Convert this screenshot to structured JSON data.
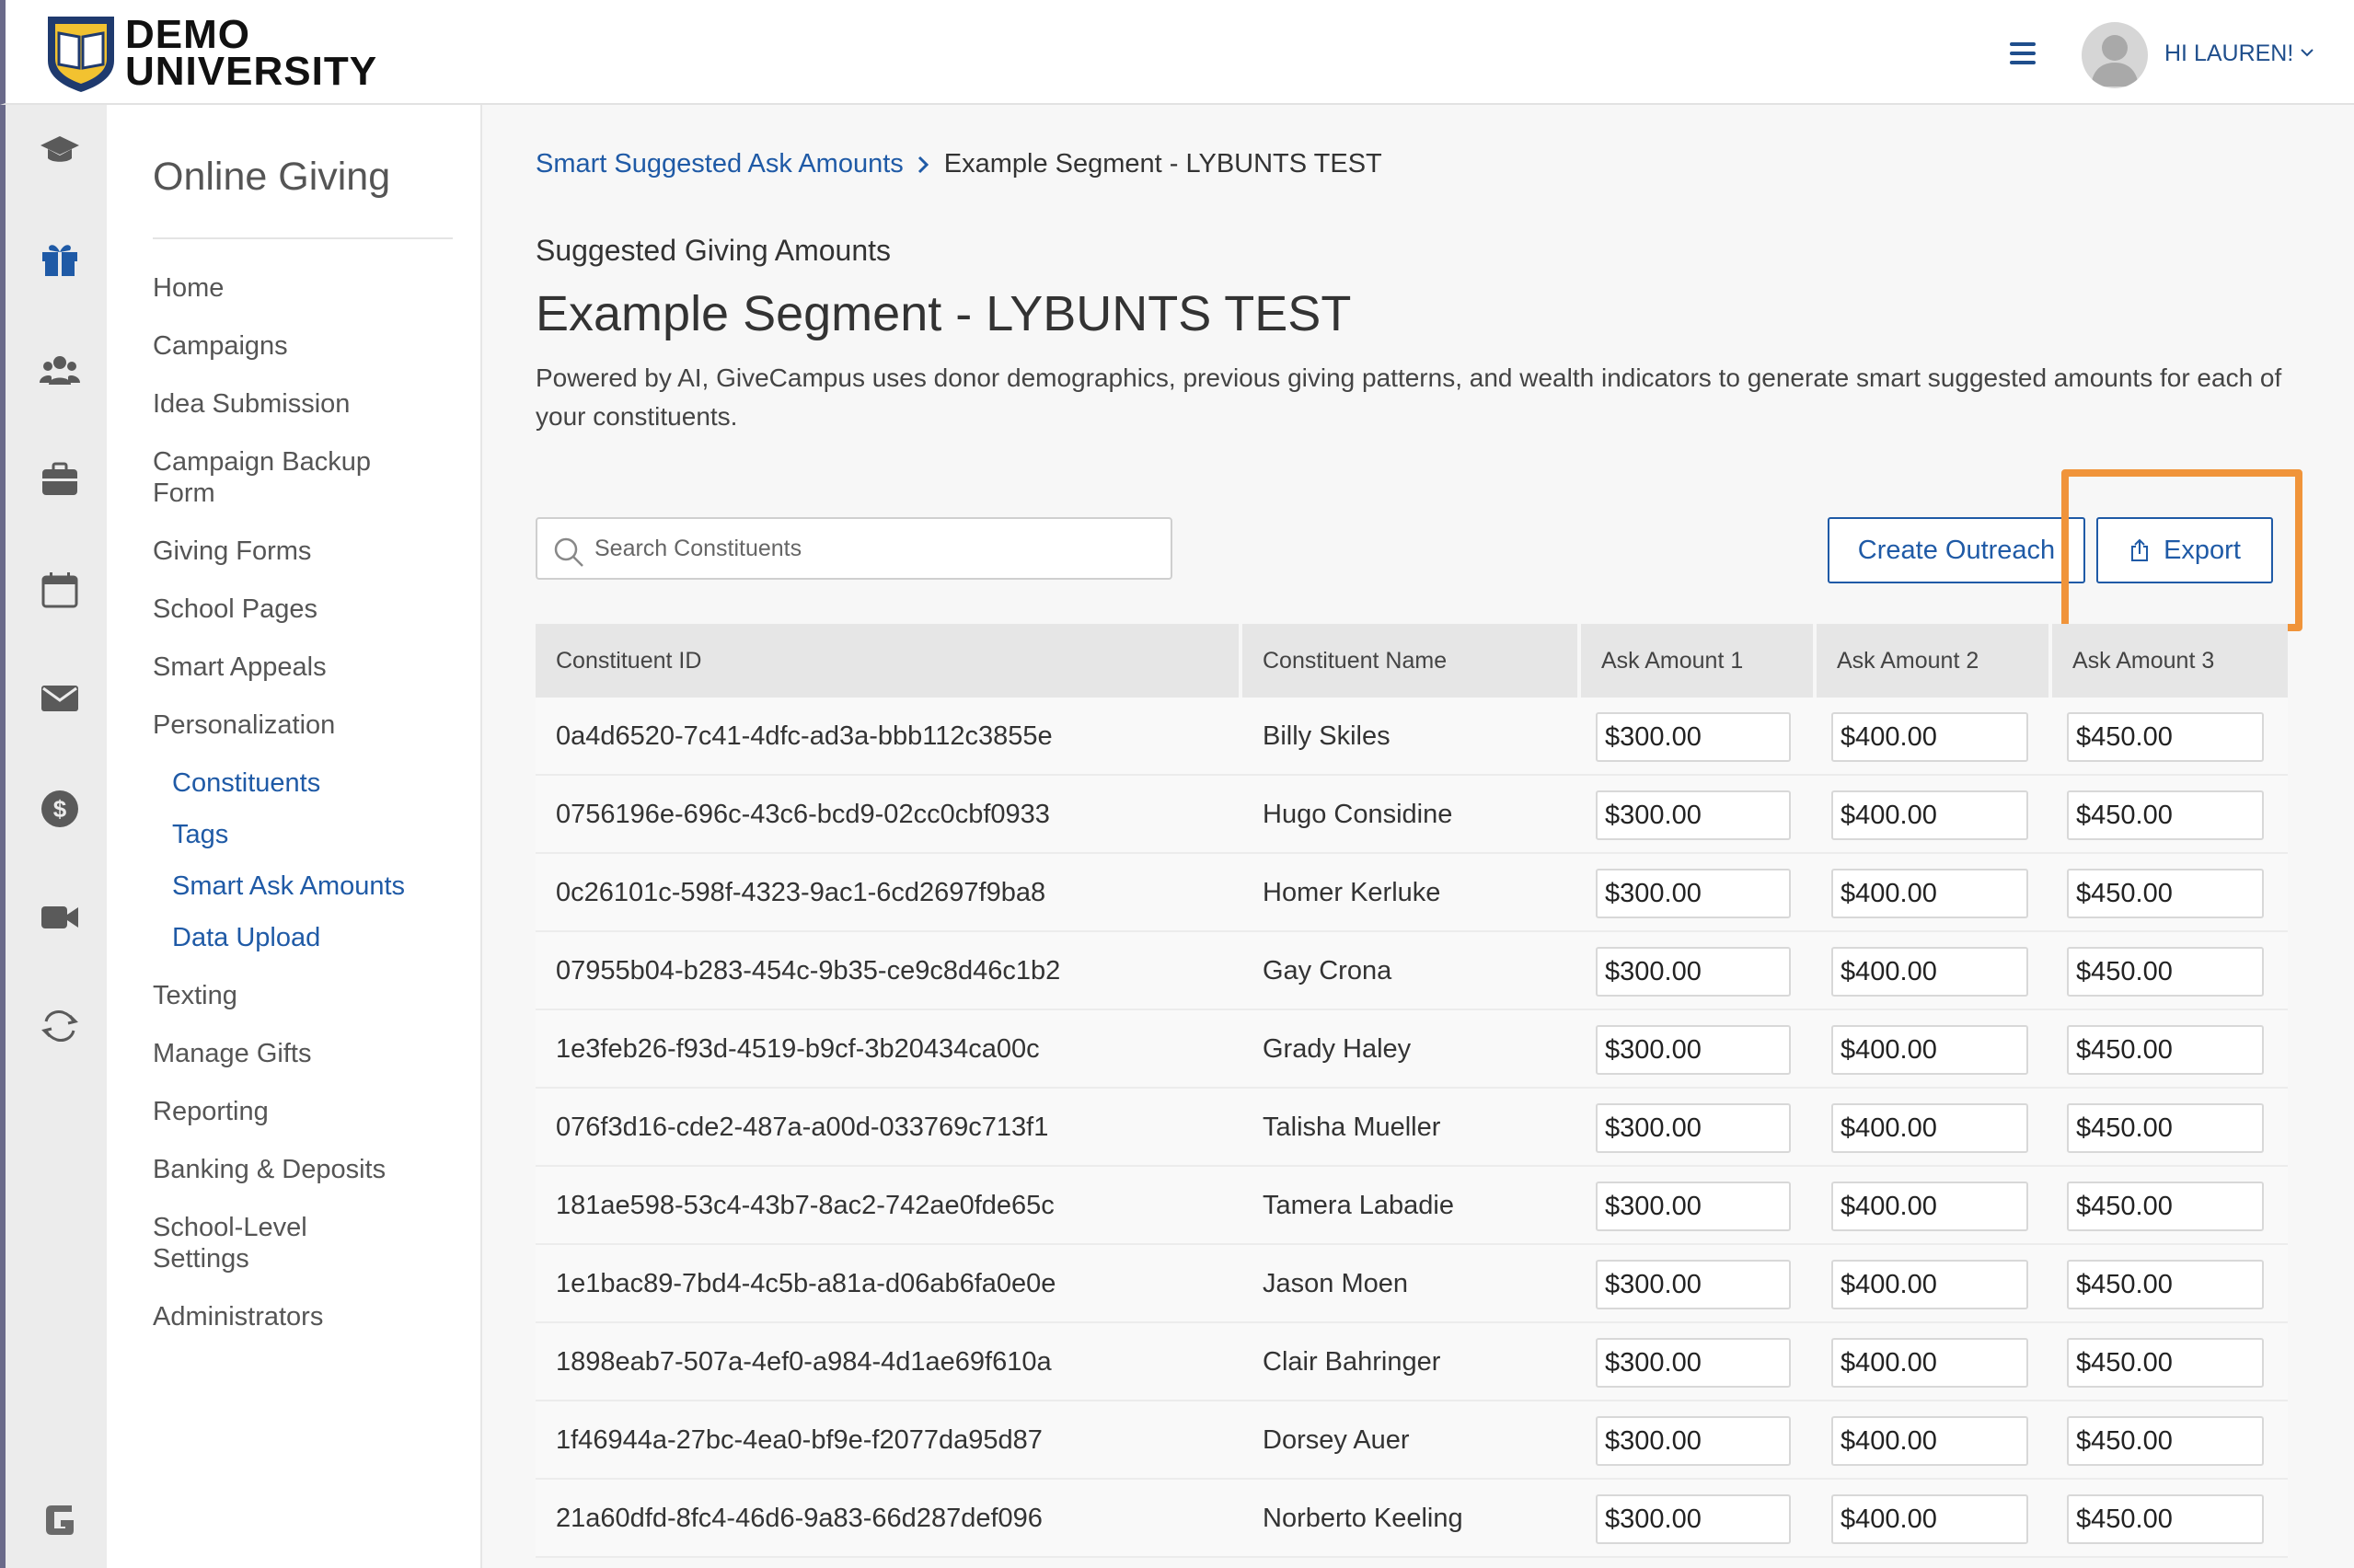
{
  "header": {
    "logo_line1": "DEMO",
    "logo_line2": "UNIVERSITY",
    "greeting": "HI LAUREN!",
    "menu_icon": "hamburger-icon",
    "user_menu_icon": "chevron-down-icon"
  },
  "rail": {
    "icons": [
      "graduation-cap-icon",
      "gift-icon",
      "people-icon",
      "briefcase-icon",
      "calendar-icon",
      "envelope-icon",
      "dollar-icon",
      "video-camera-icon",
      "sync-icon",
      "brand-g-icon"
    ]
  },
  "subnav": {
    "title": "Online Giving",
    "items": {
      "home": "Home",
      "campaigns": "Campaigns",
      "idea_submission": "Idea Submission",
      "campaign_backup_form": "Campaign Backup Form",
      "giving_forms": "Giving Forms",
      "school_pages": "School Pages",
      "smart_appeals": "Smart Appeals",
      "personalization": "Personalization",
      "constituents": "Constituents",
      "tags": "Tags",
      "smart_ask_amounts": "Smart Ask Amounts",
      "data_upload": "Data Upload",
      "texting": "Texting",
      "manage_gifts": "Manage Gifts",
      "reporting": "Reporting",
      "banking_deposits": "Banking & Deposits",
      "school_level_settings": "School-Level Settings",
      "administrators": "Administrators"
    }
  },
  "main": {
    "breadcrumb_parent": "Smart Suggested Ask Amounts",
    "breadcrumb_current": "Example Segment - LYBUNTS TEST",
    "subheading": "Suggested Giving Amounts",
    "heading": "Example Segment - LYBUNTS TEST",
    "description": "Powered by AI, GiveCampus uses donor demographics, previous giving patterns, and wealth indicators to generate smart suggested amounts for each of your constituents.",
    "search_placeholder": "Search Constituents",
    "create_outreach_label": "Create Outreach",
    "export_label": "Export",
    "highlight_color": "#f0943a",
    "accent_color": "#1f5aa6"
  },
  "table": {
    "headers": {
      "id": "Constituent ID",
      "name": "Constituent Name",
      "ask1": "Ask Amount 1",
      "ask2": "Ask Amount 2",
      "ask3": "Ask Amount 3"
    },
    "rows": [
      {
        "id": "0a4d6520-7c41-4dfc-ad3a-bbb112c3855e",
        "name": "Billy Skiles",
        "ask1": "$300.00",
        "ask2": "$400.00",
        "ask3": "$450.00"
      },
      {
        "id": "0756196e-696c-43c6-bcd9-02cc0cbf0933",
        "name": "Hugo Considine",
        "ask1": "$300.00",
        "ask2": "$400.00",
        "ask3": "$450.00"
      },
      {
        "id": "0c26101c-598f-4323-9ac1-6cd2697f9ba8",
        "name": "Homer Kerluke",
        "ask1": "$300.00",
        "ask2": "$400.00",
        "ask3": "$450.00"
      },
      {
        "id": "07955b04-b283-454c-9b35-ce9c8d46c1b2",
        "name": "Gay Crona",
        "ask1": "$300.00",
        "ask2": "$400.00",
        "ask3": "$450.00"
      },
      {
        "id": "1e3feb26-f93d-4519-b9cf-3b20434ca00c",
        "name": "Grady Haley",
        "ask1": "$300.00",
        "ask2": "$400.00",
        "ask3": "$450.00"
      },
      {
        "id": "076f3d16-cde2-487a-a00d-033769c713f1",
        "name": "Talisha Mueller",
        "ask1": "$300.00",
        "ask2": "$400.00",
        "ask3": "$450.00"
      },
      {
        "id": "181ae598-53c4-43b7-8ac2-742ae0fde65c",
        "name": "Tamera Labadie",
        "ask1": "$300.00",
        "ask2": "$400.00",
        "ask3": "$450.00"
      },
      {
        "id": "1e1bac89-7bd4-4c5b-a81a-d06ab6fa0e0e",
        "name": "Jason Moen",
        "ask1": "$300.00",
        "ask2": "$400.00",
        "ask3": "$450.00"
      },
      {
        "id": "1898eab7-507a-4ef0-a984-4d1ae69f610a",
        "name": "Clair Bahringer",
        "ask1": "$300.00",
        "ask2": "$400.00",
        "ask3": "$450.00"
      },
      {
        "id": "1f46944a-27bc-4ea0-bf9e-f2077da95d87",
        "name": "Dorsey Auer",
        "ask1": "$300.00",
        "ask2": "$400.00",
        "ask3": "$450.00"
      },
      {
        "id": "21a60dfd-8fc4-46d6-9a83-66d287def096",
        "name": "Norberto Keeling",
        "ask1": "$300.00",
        "ask2": "$400.00",
        "ask3": "$450.00"
      }
    ]
  }
}
